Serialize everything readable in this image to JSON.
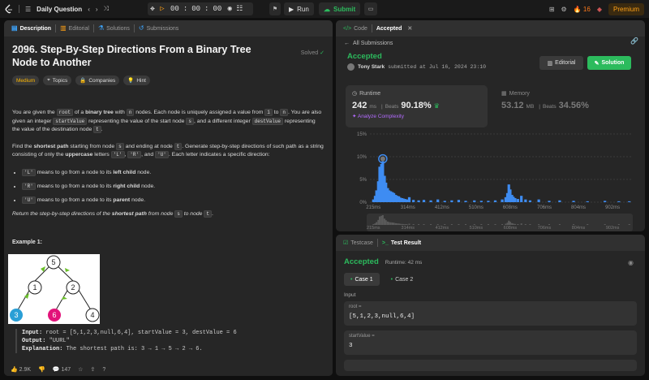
{
  "topbar": {
    "title": "Daily Question",
    "timer": {
      "h": "00",
      "m": "00",
      "s": "00"
    },
    "run_label": "Run",
    "submit_label": "Submit",
    "streak": "16",
    "premium_label": "Premium"
  },
  "left_tabs": [
    "Description",
    "Editorial",
    "Solutions",
    "Submissions"
  ],
  "problem": {
    "title": "2096. Step-By-Step Directions From a Binary Tree Node to Another",
    "solved_label": "Solved",
    "tags": [
      "Medium",
      "Topics",
      "Companies",
      "Hint"
    ],
    "p1": {
      "a": "You are given the ",
      "c1": "root",
      "b": " of a ",
      "b2": "binary tree",
      "c": " with ",
      "c2": "n",
      "d": " nodes. Each node is uniquely assigned a value from ",
      "c3": "1",
      "e": " to ",
      "c4": "n",
      "f": ". You are also given an integer ",
      "c5": "startValue",
      "g": " representing the value of the start node ",
      "c6": "s",
      "h": ", and a different integer ",
      "c7": "destValue",
      "i": " representing the value of the destination node ",
      "c8": "t",
      "j": "."
    },
    "p2": {
      "a": "Find the ",
      "b1": "shortest path",
      "b": " starting from node ",
      "c1": "s",
      "c": " and ending at node ",
      "c2": "t",
      "d": ". Generate step-by-step directions of such path as a string consisting of only the ",
      "b2": "uppercase",
      "e": " letters ",
      "c3": "'L'",
      "f": ", ",
      "c4": "'R'",
      "g": ", and ",
      "c5": "'U'",
      "h": ". Each letter indicates a specific direction:"
    },
    "bullets": [
      {
        "code": "'L'",
        "pre": " means to go from a node to its ",
        "bold": "left child",
        "post": " node."
      },
      {
        "code": "'R'",
        "pre": " means to go from a node to its ",
        "bold": "right child",
        "post": " node."
      },
      {
        "code": "'U'",
        "pre": " means to go from a node to its ",
        "bold": "parent",
        "post": " node."
      }
    ],
    "p3": {
      "a": "Return the step-by-step directions of the ",
      "b": "shortest path",
      "c": " from node ",
      "c1": "s",
      "d": " to node ",
      "c2": "t",
      "e": "."
    },
    "example_title": "Example 1:",
    "tree_nodes": [
      "5",
      "1",
      "2",
      "3",
      "6",
      "4"
    ],
    "example": {
      "input_label": "Input:",
      "input": "root = [5,1,2,3,null,6,4], startValue = 3, destValue = 6",
      "output_label": "Output:",
      "output": "\"UURL\"",
      "expl_label": "Explanation:",
      "expl": "The shortest path is: 3 → 1 → 5 → 2 → 6."
    },
    "likes": "2.9K",
    "comments": "147"
  },
  "right_tabs": {
    "code": "Code",
    "accepted": "Accepted"
  },
  "submission": {
    "back_label": "All Submissions",
    "status": "Accepted",
    "user": "Tony Stark",
    "submitted": "submitted at Jul 16, 2024 23:10",
    "editorial_label": "Editorial",
    "solution_label": "Solution",
    "runtime_label": "Runtime",
    "runtime_value": "242",
    "runtime_unit": "ms",
    "beats_label": "Beats",
    "runtime_beats": "90.18%",
    "analyze_label": "Analyze Complexity",
    "memory_label": "Memory",
    "memory_value": "53.12",
    "memory_unit": "MB",
    "memory_beats": "34.56%"
  },
  "chart_data": {
    "type": "bar",
    "ylim": [
      0,
      15
    ],
    "y_ticks": [
      "15%",
      "10%",
      "5%",
      "0%"
    ],
    "x_ticks": [
      "215ms",
      "314ms",
      "412ms",
      "510ms",
      "608ms",
      "706ms",
      "804ms",
      "902ms"
    ],
    "x_range": [
      205,
      960
    ],
    "bars_x": [
      215,
      220,
      224,
      229,
      233,
      238,
      242,
      247,
      251,
      256,
      260,
      265,
      270,
      274,
      279,
      283,
      288,
      292,
      297,
      301,
      306,
      311,
      318,
      330,
      345,
      360,
      380,
      400,
      420,
      440,
      460,
      480,
      505,
      525,
      545,
      565,
      585,
      595,
      600,
      604,
      608,
      613,
      617,
      622,
      630,
      640,
      652,
      665,
      690,
      720,
      750,
      790,
      830,
      880,
      920,
      950
    ],
    "values": [
      0.6,
      1.4,
      2.6,
      4.6,
      7.8,
      8.4,
      9.0,
      5.8,
      4.3,
      3.1,
      2.6,
      2.4,
      2.2,
      2.0,
      1.6,
      1.4,
      1.3,
      1.0,
      0.9,
      0.8,
      0.7,
      0.6,
      1.1,
      0.5,
      0.4,
      0.5,
      0.4,
      0.6,
      0.3,
      0.4,
      0.5,
      0.3,
      0.4,
      0.3,
      0.3,
      0.4,
      0.6,
      1.1,
      2.0,
      3.9,
      2.8,
      1.6,
      1.2,
      0.9,
      0.7,
      1.4,
      0.6,
      0.4,
      0.6,
      0.3,
      0.4,
      0.3,
      0.2,
      0.3,
      0.2,
      0.2
    ],
    "highlight_x": 242
  },
  "bottom": {
    "tab_testcase": "Testcase",
    "tab_result": "Test Result",
    "status": "Accepted",
    "runtime": "Runtime: 42 ms",
    "cases": [
      "Case 1",
      "Case 2"
    ],
    "input_label": "Input",
    "fields": [
      {
        "label": "root =",
        "value": "[5,1,2,3,null,6,4]"
      },
      {
        "label": "startValue =",
        "value": "3"
      }
    ]
  }
}
